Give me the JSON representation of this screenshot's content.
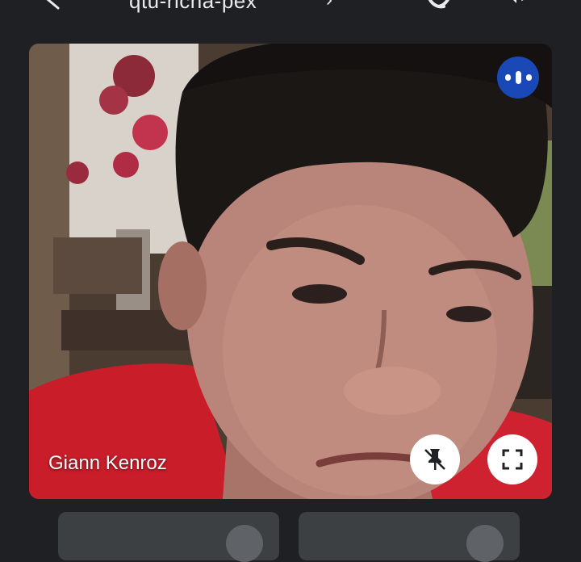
{
  "topbar": {
    "meeting_code": "qtu-rlcha-pex",
    "back_icon": "arrow-back-icon",
    "chevron_icon": "chevron-right-icon",
    "camera_switch_icon": "camera-switch-icon",
    "speaker_icon": "speaker-icon"
  },
  "main_tile": {
    "participant_name": "Giann Kenroz",
    "audio_indicator_icon": "audio-level-icon",
    "pin_icon": "unpin-icon",
    "fullscreen_icon": "fullscreen-icon"
  },
  "colors": {
    "background": "#1f2023",
    "accent_blue": "#1a49b7",
    "tile_gray": "#3c4043"
  }
}
